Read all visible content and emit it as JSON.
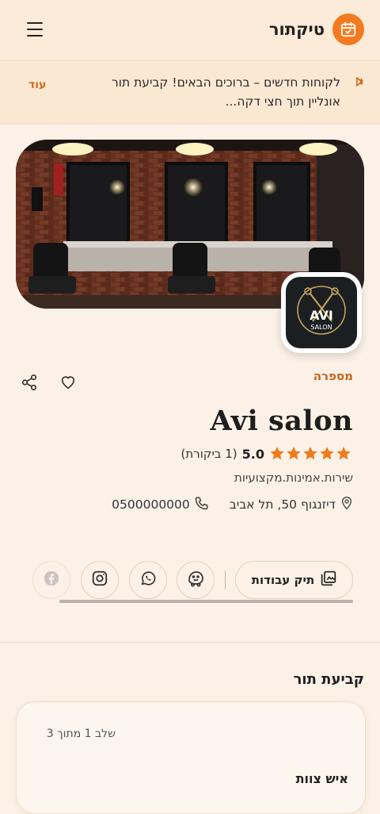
{
  "header": {
    "brand_name": "טיקתור",
    "menu_icon": "hamburger-icon",
    "logo_icon": "calendar-icon",
    "accent": "#f47a1f"
  },
  "announcement": {
    "icon": "megaphone-icon",
    "text": "לקוחות חדשים – ברוכים הבאים! קביעת תור אונליין תוך חצי דקה...",
    "more_label": "עוד"
  },
  "business": {
    "category": "מספרה",
    "name": "Avi salon",
    "rating": "5.0",
    "review_count": "(1 ביקורת)",
    "stars": 5,
    "tagline": "שירות.אמינות.מקצועיות",
    "address": "דיזנגוף 50, תל אביב",
    "phone": "0500000000",
    "logo_text_main": "AVI",
    "logo_text_sub": "SALON"
  },
  "actions": {
    "portfolio_label": "תיק עבודות",
    "portfolio_icon": "gallery-icon",
    "social": [
      {
        "name": "waze",
        "icon": "waze-icon"
      },
      {
        "name": "whatsapp",
        "icon": "whatsapp-icon"
      },
      {
        "name": "instagram",
        "icon": "instagram-icon"
      },
      {
        "name": "facebook",
        "icon": "facebook-icon"
      }
    ]
  },
  "booking": {
    "title": "קביעת תור",
    "step_text": "שלב 1 מתוך 3",
    "staff_label": "איש צוות"
  }
}
